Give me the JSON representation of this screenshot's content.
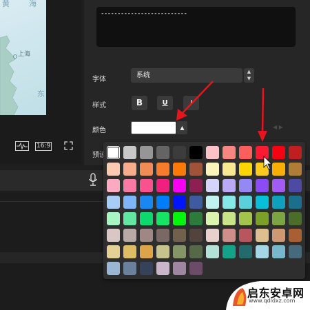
{
  "preview": {
    "map_labels": [
      "黄",
      "海",
      "上海",
      "东"
    ],
    "ratio_label": "16:9"
  },
  "text_preview": {
    "content": "--------------------------"
  },
  "settings": {
    "font_label": "字体",
    "font_value": "系统",
    "style_label": "样式",
    "bold_label": "B",
    "underline_label": "U",
    "italic_label": "I",
    "color_label": "颜色",
    "preset_label": "预设",
    "selected_color": "#ffffff"
  },
  "palette": {
    "rows": [
      [
        "#ffffff",
        "#c8c8c8",
        "#969696",
        "#646464",
        "#3c3c3c",
        "#000000",
        "#fcc1c6",
        "#f6867f",
        "#fa5f5d",
        "#fb1a34",
        "#f50311",
        "#bf1e22"
      ],
      [
        "#fbcab0",
        "#f7ad8b",
        "#f28c55",
        "#f67c2b",
        "#f97a08",
        "#a0533a",
        "#fbf5bc",
        "#f7e891",
        "#fdd501",
        "#feca1c",
        "#f9ae05",
        "#b07d36"
      ],
      [
        "#fcaac2",
        "#f879a3",
        "#f8538f",
        "#f11f7e",
        "#f801f3",
        "#8e1f53",
        "#d5d5fb",
        "#baaaf6",
        "#9488f4",
        "#8b4df3",
        "#a25cf4",
        "#4d4aa5"
      ],
      [
        "#a7cdf7",
        "#7eb5fa",
        "#1a86f0",
        "#017ef7",
        "#0016f8",
        "#3e5ba1",
        "#c1f2ef",
        "#85e9e8",
        "#58d1da",
        "#07bfd8",
        "#109fbc",
        "#1a6f8c"
      ],
      [
        "#a6f5c2",
        "#62e7a3",
        "#0ed96e",
        "#16e465",
        "#01f60d",
        "#2b7c3b",
        "#dbf5ae",
        "#c7e586",
        "#a4c54b",
        "#7ba027",
        "#7ca542",
        "#4a6e2a"
      ],
      [
        "#d8c7c5",
        "#b9a9a6",
        "#9e8784",
        "#7a6864",
        "#71604c",
        "#52443d",
        "#e8d0cc",
        "#ce8f8a",
        "#b8555d",
        "#ddbf90",
        "#ce9873",
        "#a95f31"
      ],
      [
        "#e4cf95",
        "#ddbd63",
        "#dea44a",
        "#c7c38d",
        "#869566",
        "#556948",
        "#b4e2d6",
        "#14a389",
        "#226a6b",
        "#a6d6e6",
        "#76b7cb",
        "#47697c"
      ],
      [
        "#9ab6d4",
        "#69819c",
        "#36425a",
        "#cab6cb",
        "#9f86a0",
        "#6c4b68"
      ]
    ]
  },
  "watermark": {
    "title": "启东安卓网",
    "url": "www.qdldxz.com"
  },
  "colors": {
    "accent_arrow": "#e5161b",
    "panel_bg": "#262626",
    "popup_bg": "#2e2e2e"
  }
}
